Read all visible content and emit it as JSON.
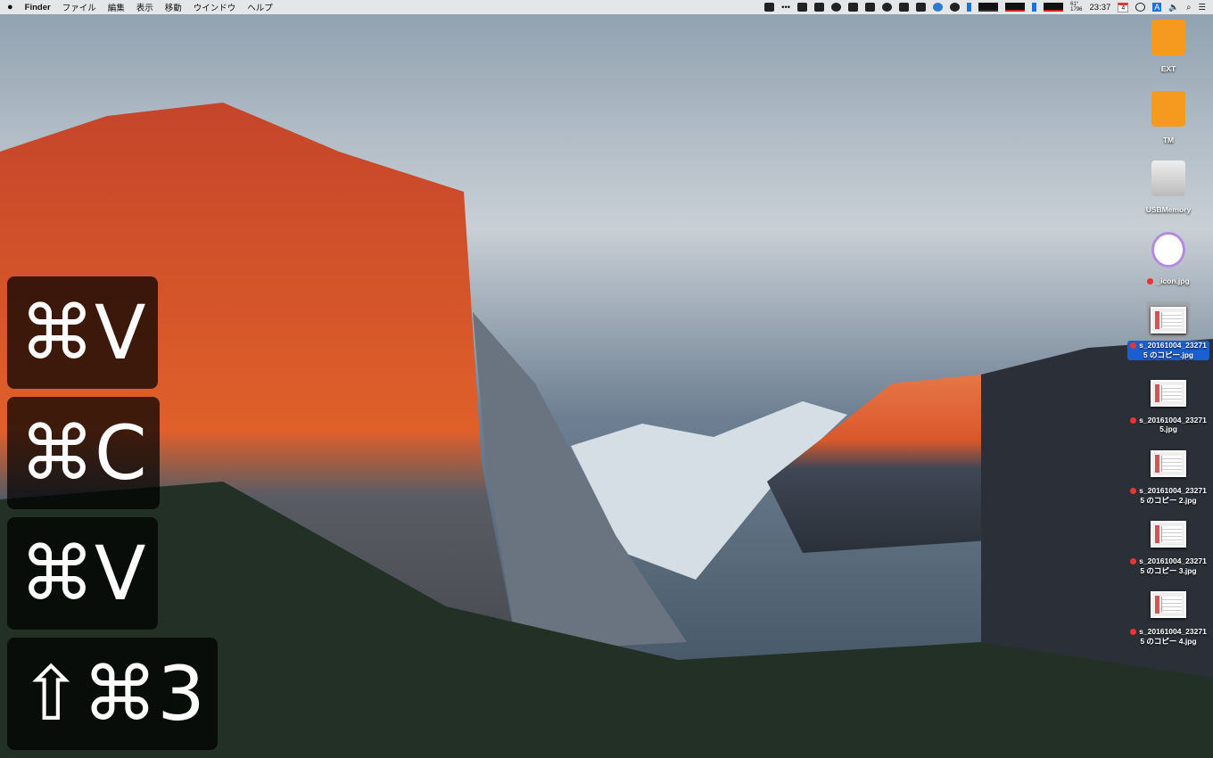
{
  "menubar": {
    "apple": "",
    "app": "Finder",
    "items": [
      "ファイル",
      "編集",
      "表示",
      "移動",
      "ウインドウ",
      "ヘルプ"
    ],
    "stats": "61°\n1796",
    "clock": "23:37",
    "calendar_day": "4",
    "input": "A"
  },
  "overlays": [
    {
      "text": "⌘V"
    },
    {
      "text": "⌘C"
    },
    {
      "text": "⌘V"
    },
    {
      "text": "⇧⌘3"
    }
  ],
  "desktop_icons": [
    {
      "label": "EXT",
      "color": "#f59a1f"
    },
    {
      "label": "TM",
      "color": "#f59a1f"
    },
    {
      "label": "USBMemory",
      "color": "#d8d8d8"
    },
    {
      "label": "_icon.jpg"
    },
    {
      "label": "s_20161004_232715 のコピー.jpg"
    },
    {
      "label": "s_20161004_232715.jpg"
    },
    {
      "label": "s_20161004_232715 のコピー 2.jpg"
    },
    {
      "label": "s_20161004_232715 のコピー 3.jpg"
    },
    {
      "label": "s_20161004_232715 のコピー 4.jpg"
    }
  ]
}
